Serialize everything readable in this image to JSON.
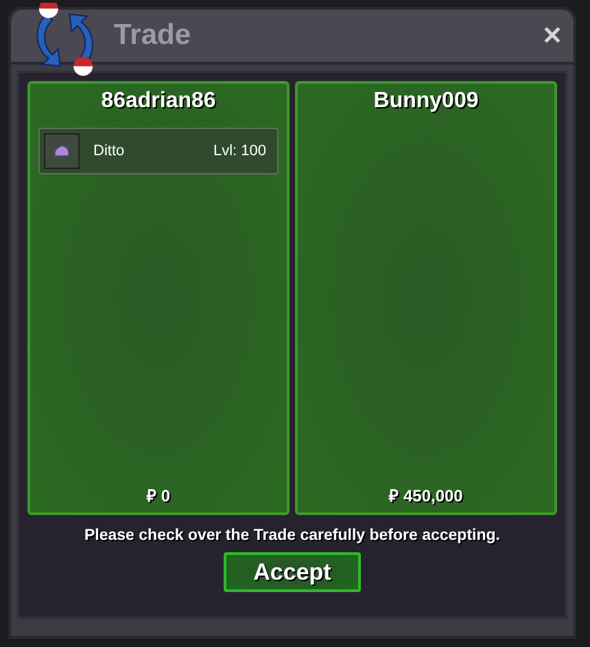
{
  "window": {
    "title": "Trade",
    "close": "✕"
  },
  "offers": [
    {
      "player": "86adrian86",
      "items": [
        {
          "name": "Ditto",
          "level": "Lvl: 100"
        }
      ],
      "money": "₽ 0"
    },
    {
      "player": "Bunny009",
      "money": "₽ 450,000"
    }
  ],
  "notice": "Please check over the Trade carefully before accepting.",
  "button": "Accept"
}
